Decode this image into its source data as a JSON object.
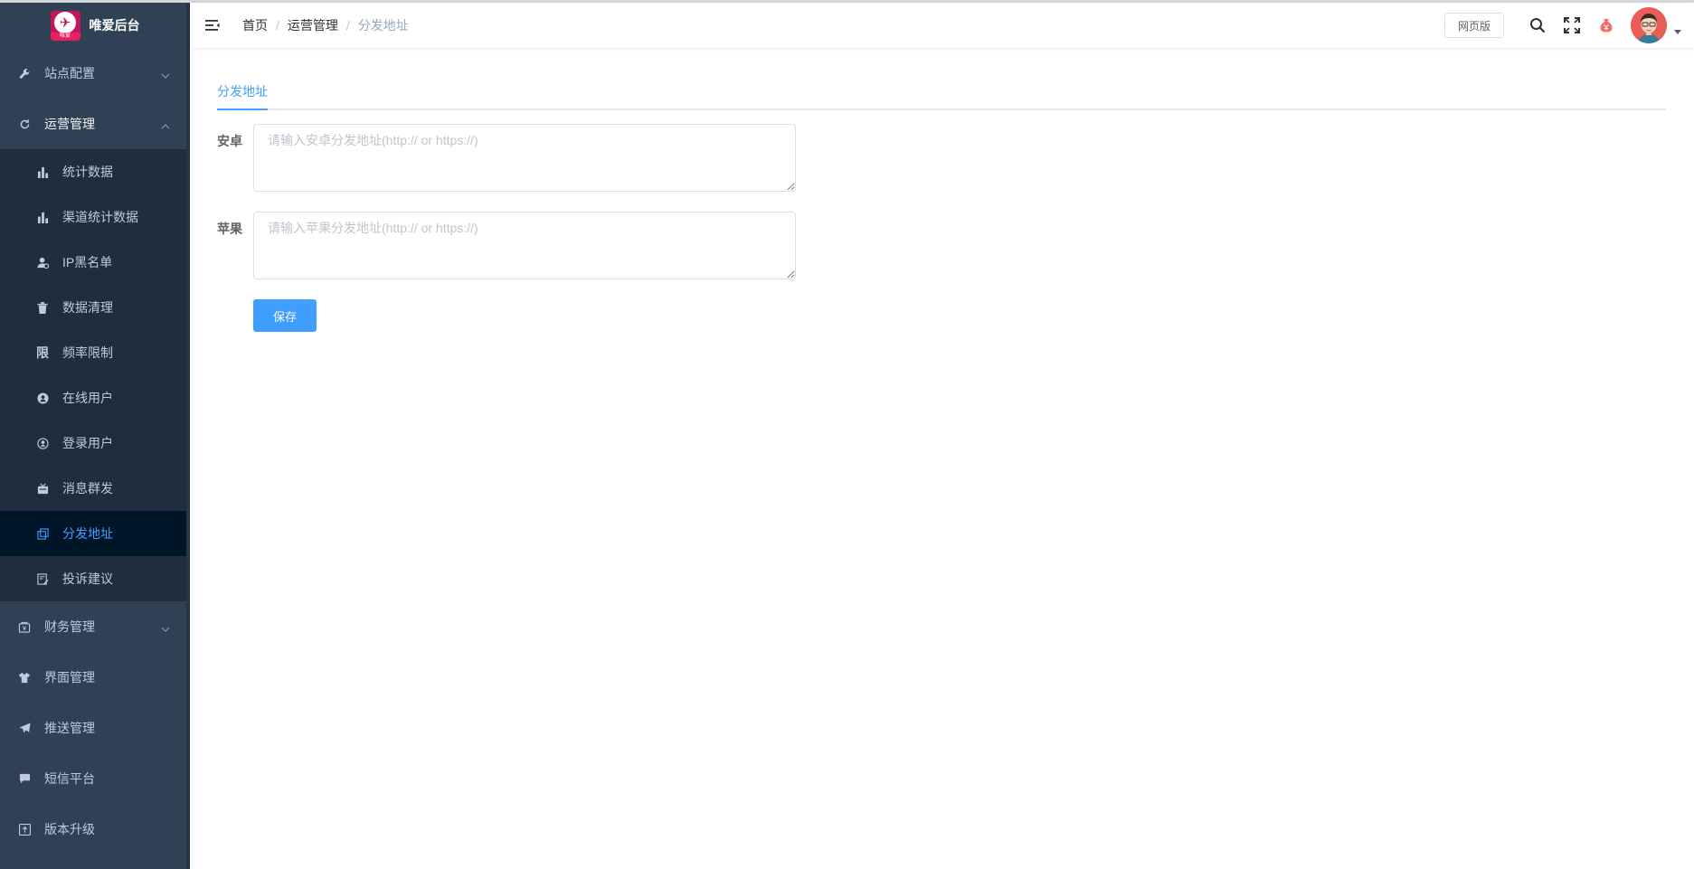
{
  "app": {
    "title": "唯爱后台",
    "logo_text": "唯爱"
  },
  "sidebar": {
    "top_before": [
      {
        "label": "站点配置",
        "icon": "wrench-icon",
        "expanded": false
      }
    ],
    "group": {
      "label": "运营管理",
      "icon": "refresh-icon",
      "expanded": true
    },
    "subitems": [
      {
        "label": "统计数据",
        "icon": "bar-chart-icon"
      },
      {
        "label": "渠道统计数据",
        "icon": "bar-chart-icon"
      },
      {
        "label": "IP黑名单",
        "icon": "user-block-icon"
      },
      {
        "label": "数据清理",
        "icon": "trash-icon"
      },
      {
        "label": "频率限制",
        "icon": "limit-char-icon",
        "glyph": "限"
      },
      {
        "label": "在线用户",
        "icon": "online-user-icon"
      },
      {
        "label": "登录用户",
        "icon": "login-user-icon"
      },
      {
        "label": "消息群发",
        "icon": "message-icon"
      },
      {
        "label": "分发地址",
        "icon": "share-icon",
        "active": true
      },
      {
        "label": "投诉建议",
        "icon": "feedback-icon"
      }
    ],
    "top_after": [
      {
        "label": "财务管理",
        "icon": "wallet-icon",
        "expandable": true
      },
      {
        "label": "界面管理",
        "icon": "shirt-icon"
      },
      {
        "label": "推送管理",
        "icon": "send-icon"
      },
      {
        "label": "短信平台",
        "icon": "chat-icon"
      },
      {
        "label": "版本升级",
        "icon": "upgrade-icon"
      }
    ]
  },
  "navbar": {
    "breadcrumb": [
      "首页",
      "运营管理",
      "分发地址"
    ],
    "separator": "/",
    "web_version_label": "网页版"
  },
  "main": {
    "tab_label": "分发地址",
    "android_label": "安卓",
    "android_value": "",
    "android_placeholder": "请输入安卓分发地址(http:// or https://)",
    "ios_label": "苹果",
    "ios_value": "",
    "ios_placeholder": "请输入苹果分发地址(http:// or https://)",
    "save_label": "保存"
  },
  "colors": {
    "sidebar_bg": "#304156",
    "submenu_bg": "#1f2d3d",
    "active_bg": "#001528",
    "accent": "#409eff",
    "menu_text": "#bfcbd9"
  }
}
